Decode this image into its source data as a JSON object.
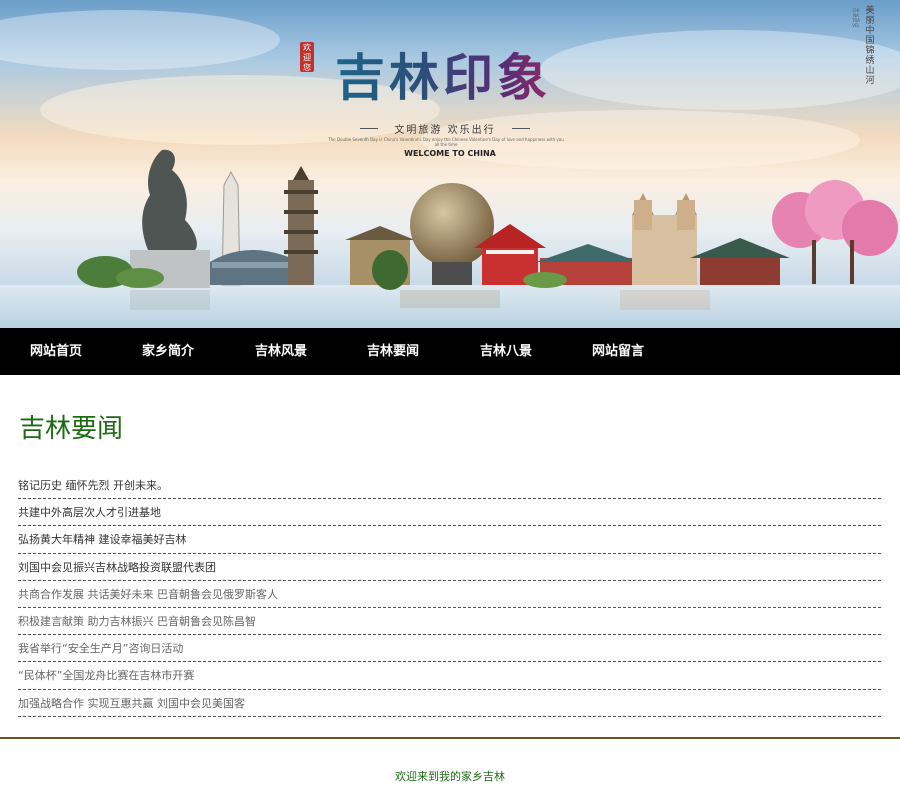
{
  "banner": {
    "title": "吉林印象",
    "seal": "欢迎您",
    "subtitle": "文明旅游 欢乐出行",
    "fine_print": "The Double Seventh Day is China's Valentine's Day enjoy the Chinese Valentine's Day of love and happiness with you all the time",
    "welcome": "WELCOME TO CHINA",
    "vertical_text": "美丽中国 锦绣山河",
    "vertical_small": "CHINA TRAVEL"
  },
  "nav": {
    "items": [
      {
        "label": "网站首页"
      },
      {
        "label": "家乡简介"
      },
      {
        "label": "吉林风景"
      },
      {
        "label": "吉林要闻"
      },
      {
        "label": "吉林八景"
      },
      {
        "label": "网站留言"
      }
    ]
  },
  "main": {
    "section_title": "吉林要闻",
    "news": [
      "铭记历史 缅怀先烈 开创未来。",
      "共建中外高层次人才引进基地",
      "弘扬黄大年精神 建设幸福美好吉林",
      "刘国中会见振兴吉林战略投资联盟代表团",
      "共商合作发展 共话美好未来 巴音朝鲁会见俄罗斯客人",
      "积极建言献策 助力吉林振兴 巴音朝鲁会见陈昌智",
      "我省举行“安全生产月”咨询日活动",
      "“民体杯”全国龙舟比赛在吉林市开赛",
      "加强战略合作 实现互惠共赢 刘国中会见美国客"
    ]
  },
  "footer": {
    "text": "欢迎来到我的家乡吉林"
  },
  "colors": {
    "nav_bg": "#000000",
    "nav_text": "#ffffff",
    "title_green": "#1e6b14",
    "footer_rule": "#6b5220"
  }
}
